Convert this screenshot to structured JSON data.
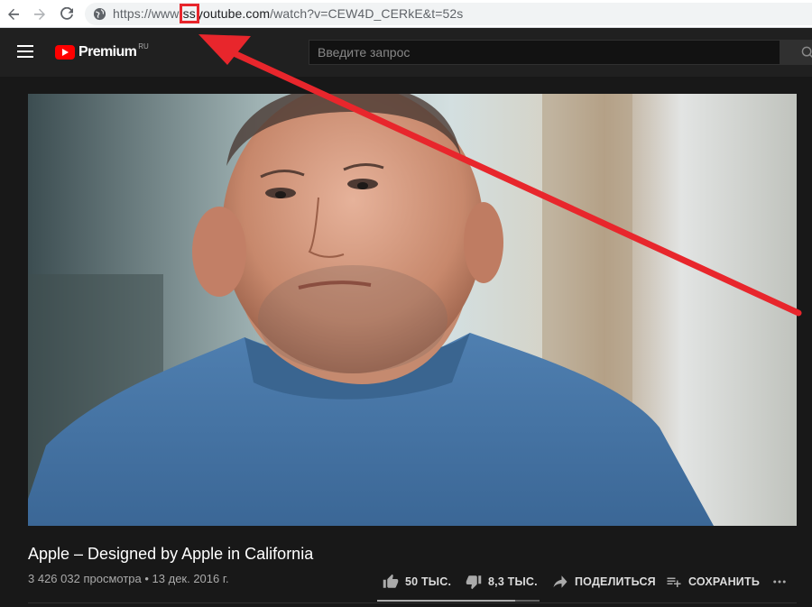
{
  "browser": {
    "url_prefix": "https://www.",
    "url_highlight": "ss",
    "url_host_rest": "youtube.com",
    "url_path": "/watch?v=CEW4D_CERkE&t=52s"
  },
  "masthead": {
    "logo_text": "Premium",
    "logo_region": "RU",
    "search_placeholder": "Введите запрос"
  },
  "video": {
    "title": "Apple – Designed by Apple in California",
    "views": "3 426 032 просмотра",
    "date": "13 дек. 2016 г.",
    "like_count": "50 ТЫС.",
    "dislike_count": "8,3 ТЫС.",
    "share_label": "ПОДЕЛИТЬСЯ",
    "save_label": "СОХРАНИТЬ",
    "like_ratio": 0.85
  },
  "colors": {
    "annotation": "#e8262c",
    "brand": "#ff0000"
  }
}
